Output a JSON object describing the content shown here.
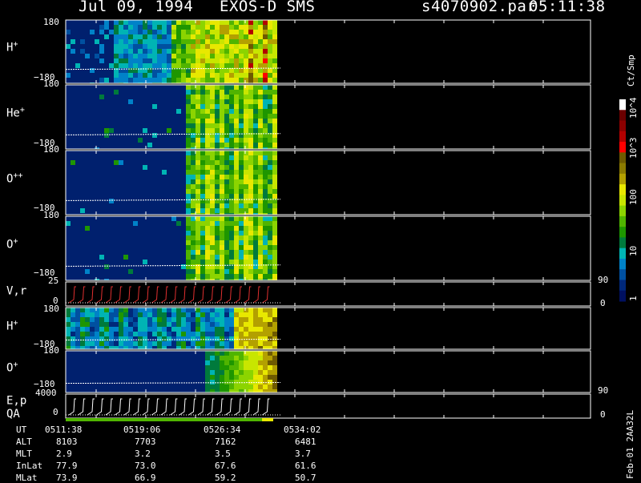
{
  "header": {
    "date": "Jul 09, 1994",
    "instrument": "EXOS-D SMS",
    "file": "s4070902.par",
    "time": "05:11:38"
  },
  "colorbar": {
    "unit": "Ct/Smp",
    "tick_labels": [
      "10^4",
      "10^3",
      "100",
      "10",
      "1"
    ],
    "colors": [
      "#ffffff",
      "#6b0000",
      "#8b0000",
      "#b30000",
      "#ff0000",
      "#6e5a00",
      "#8b7a00",
      "#b3a000",
      "#e8e800",
      "#c8e600",
      "#8cd400",
      "#50b400",
      "#1e9600",
      "#007a3c",
      "#00b4b4",
      "#0082c8",
      "#0050a0",
      "#00287a",
      "#001060"
    ]
  },
  "panels": [
    {
      "label": "H",
      "sup": "+",
      "top": "180",
      "bottom": "−180"
    },
    {
      "label": "He",
      "sup": "+",
      "top": "180",
      "bottom": "−180"
    },
    {
      "label": "O",
      "sup": "++",
      "top": "180",
      "bottom": "−180"
    },
    {
      "label": "O",
      "sup": "+",
      "top": "180",
      "bottom": "−180"
    },
    {
      "label": "V,r",
      "sup": "",
      "top": "25",
      "bottom": "0",
      "right_top": "90",
      "right_bottom": "0"
    },
    {
      "label": "H",
      "sup": "+",
      "top": "180",
      "bottom": "−180"
    },
    {
      "label": "O",
      "sup": "+",
      "top": "180",
      "bottom": "−180"
    },
    {
      "label": "E,p",
      "sup": "",
      "top": "4000",
      "bottom": "0",
      "right_top": "90",
      "right_bottom": "0"
    }
  ],
  "qa_label": "QA",
  "ephemeris": {
    "row_labels": [
      "UT",
      "ALT",
      "MLT",
      "InLat",
      "MLat"
    ],
    "columns": [
      [
        "0511:38",
        "8103",
        "2.9",
        "77.9",
        "73.9"
      ],
      [
        "0519:06",
        "7703",
        "3.2",
        "73.0",
        "66.9"
      ],
      [
        "0526:34",
        "7162",
        "3.5",
        "67.6",
        "59.2"
      ],
      [
        "0534:02",
        "6481",
        "3.7",
        "61.6",
        "50.7"
      ]
    ]
  },
  "footer_vertical": "Feb-01 2AA32L",
  "chart_data": {
    "type": "heatmap",
    "title": "Jul 09, 1994   EXOS-D SMS",
    "xlabel": "UT",
    "x_ticks": [
      "0511:38",
      "0519:06",
      "0526:34",
      "0534:02"
    ],
    "series": [
      {
        "name": "H+",
        "ylim": [
          -180,
          180
        ]
      },
      {
        "name": "He+",
        "ylim": [
          -180,
          180
        ]
      },
      {
        "name": "O++",
        "ylim": [
          -180,
          180
        ]
      },
      {
        "name": "O+",
        "ylim": [
          -180,
          180
        ]
      },
      {
        "name": "V,r",
        "ylim": [
          0,
          25
        ],
        "right_ylim": [
          0,
          90
        ]
      },
      {
        "name": "H+",
        "ylim": [
          -180,
          180
        ]
      },
      {
        "name": "O+",
        "ylim": [
          -180,
          180
        ]
      },
      {
        "name": "E,p",
        "ylim": [
          0,
          4000
        ],
        "right_ylim": [
          0,
          90
        ]
      }
    ],
    "colorbar_scale": "log",
    "colorbar_range": [
      1,
      10000
    ]
  }
}
